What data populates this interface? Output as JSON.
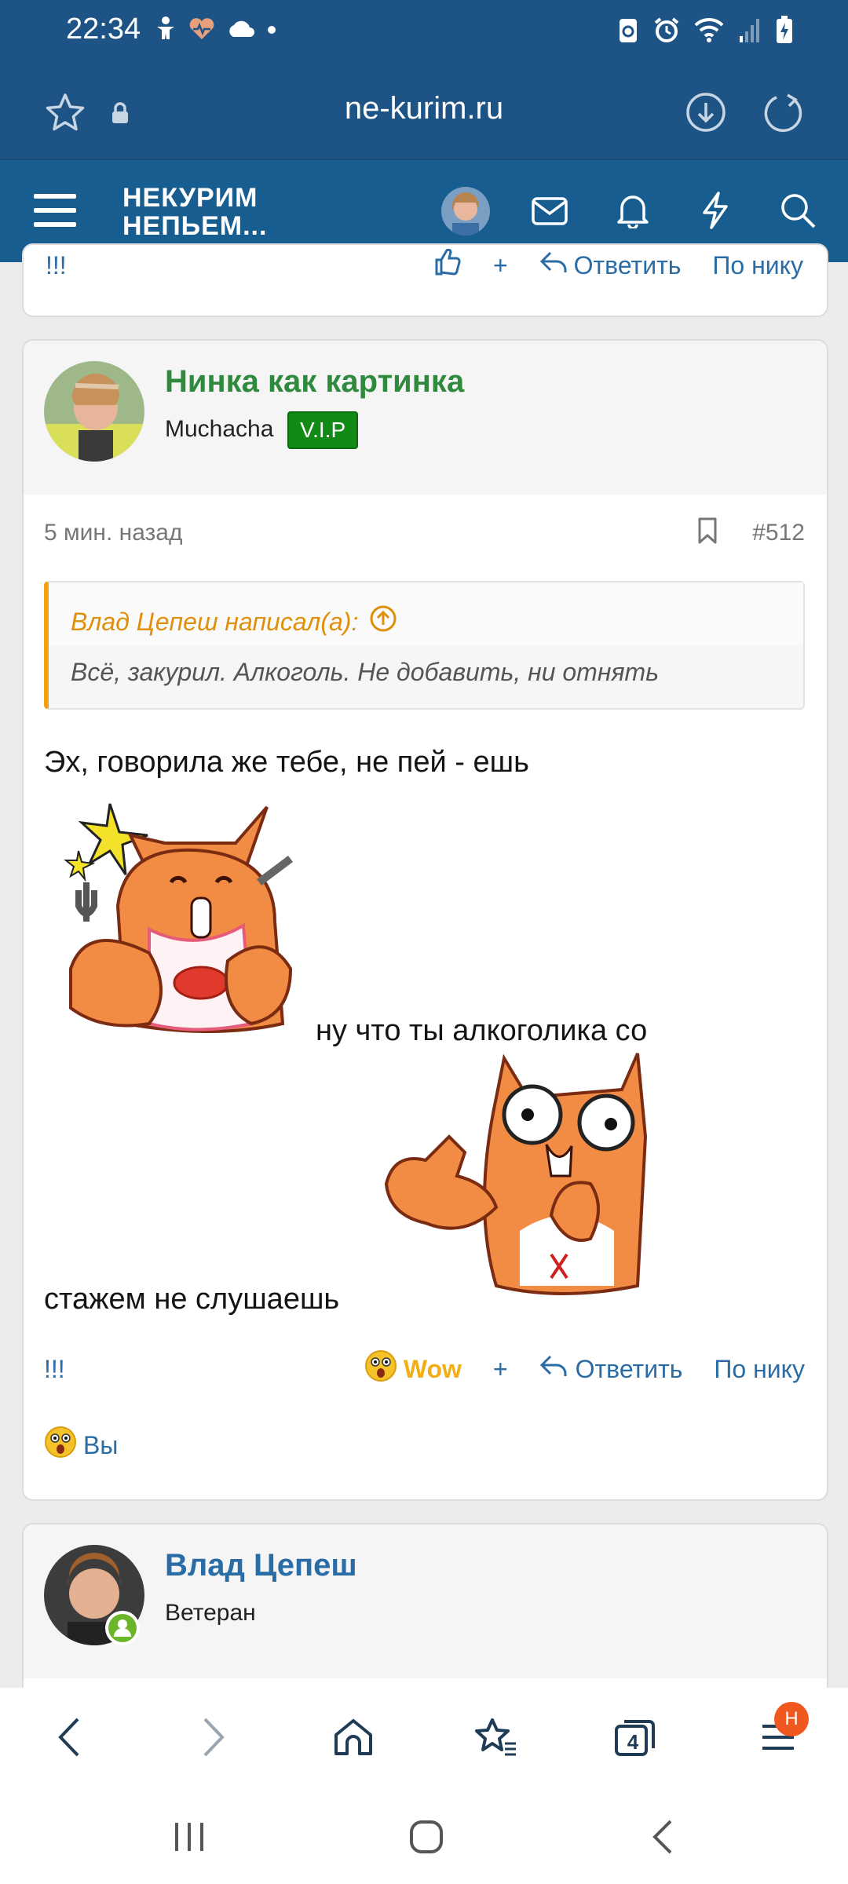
{
  "status_bar": {
    "time": "22:34"
  },
  "browser": {
    "url": "ne-kurim.ru",
    "tabs_count": "4",
    "menu_badge": "H"
  },
  "header": {
    "logo_line1": "НЕКУРИМ",
    "logo_line2": "НЕПЬЕМ..."
  },
  "prev_post": {
    "reaction_label": "!!!",
    "plus": "+",
    "reply_label": "Ответить",
    "by_nick_label": "По нику"
  },
  "post": {
    "author": "Нинка как картинка",
    "author_color": "#2f8a3e",
    "user_title": "Muchacha",
    "badge": "V.I.P",
    "time_ago": "5 мин. назад",
    "number": "#512",
    "quote_author": "Влад Цепеш написал(а):",
    "quote_text": "Всё, закурил. Алкоголь. Не добавить, ни отнять",
    "text_line1": "Эх, говорила же тебе, не пей - ешь",
    "text_line2": "ну что ты алкоголика со",
    "text_line3": "стажем не слушаешь",
    "actions": {
      "reaction_label": "!!!",
      "wow_label": "Wow",
      "plus": "+",
      "reply_label": "Ответить",
      "by_nick_label": "По нику"
    },
    "reacted_by": "Вы"
  },
  "next_post": {
    "author": "Влад Цепеш",
    "author_color": "#2a6ca5",
    "user_title": "Ветеран"
  },
  "colors": {
    "header_bg": "#1d5485",
    "link": "#2a6ca5",
    "quote_accent": "#f1a112"
  }
}
